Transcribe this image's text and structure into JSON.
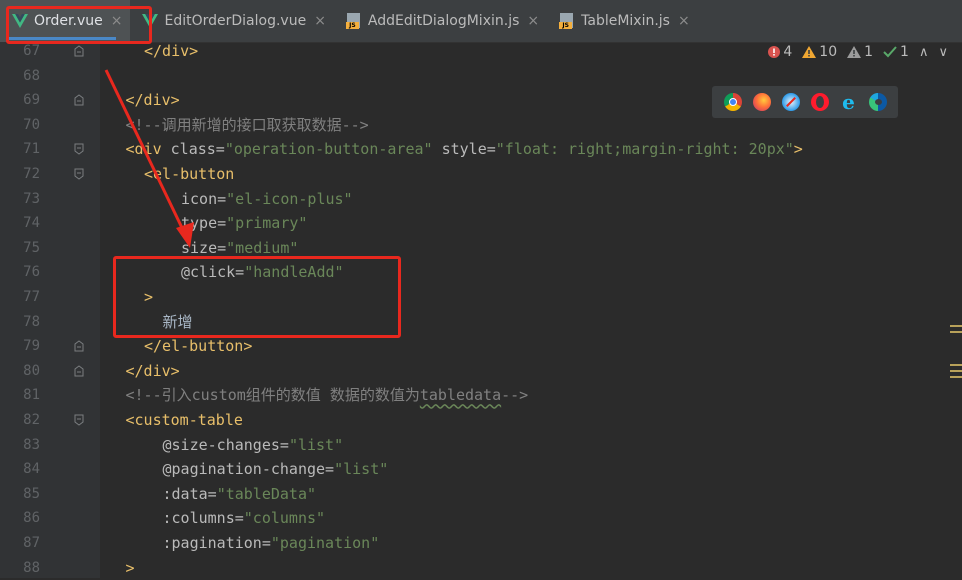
{
  "tabs": [
    {
      "label": "Order.vue",
      "icon": "vue-icon",
      "active": true
    },
    {
      "label": "EditOrderDialog.vue",
      "icon": "vue-icon",
      "active": false
    },
    {
      "label": "AddEditDialogMixin.js",
      "icon": "js-icon",
      "active": false
    },
    {
      "label": "TableMixin.js",
      "icon": "js-icon",
      "active": false
    }
  ],
  "close_glyph": "×",
  "js_badge": "JS",
  "inspections": {
    "errors": "4",
    "warnings": "10",
    "weak_warnings": "1",
    "ok": "1",
    "up": "∧",
    "down": "∨"
  },
  "browsers": [
    "chrome-icon",
    "firefox-icon",
    "safari-icon",
    "opera-icon",
    "ie-icon",
    "edge-icon"
  ],
  "lines": [
    {
      "num": "67",
      "indent": 2,
      "parts": [
        [
          "tag",
          "</div>"
        ]
      ]
    },
    {
      "num": "68",
      "indent": 0,
      "parts": []
    },
    {
      "num": "69",
      "indent": 1,
      "parts": [
        [
          "tag",
          "</div>"
        ]
      ]
    },
    {
      "num": "70",
      "indent": 1,
      "parts": [
        [
          "cmt",
          "<!--调用新增的接口取获取数据-->"
        ]
      ]
    },
    {
      "num": "71",
      "indent": 1,
      "parts": [
        [
          "tag",
          "<div "
        ],
        [
          "attr",
          "class="
        ],
        [
          "val",
          "\"operation-button-area\" "
        ],
        [
          "attr",
          "style="
        ],
        [
          "val",
          "\"float: right;margin-right: 20px\""
        ],
        [
          "tag",
          ">"
        ]
      ]
    },
    {
      "num": "72",
      "indent": 2,
      "parts": [
        [
          "tag",
          "<el-button"
        ]
      ]
    },
    {
      "num": "73",
      "indent": 4,
      "parts": [
        [
          "attr",
          "icon="
        ],
        [
          "val",
          "\"el-icon-plus\""
        ]
      ]
    },
    {
      "num": "74",
      "indent": 4,
      "parts": [
        [
          "attr",
          "type="
        ],
        [
          "val",
          "\"primary\""
        ]
      ]
    },
    {
      "num": "75",
      "indent": 4,
      "parts": [
        [
          "attr",
          "size="
        ],
        [
          "val",
          "\"medium\""
        ]
      ]
    },
    {
      "num": "76",
      "indent": 4,
      "parts": [
        [
          "attr",
          "@click="
        ],
        [
          "val",
          "\"handleAdd\""
        ]
      ]
    },
    {
      "num": "77",
      "indent": 2,
      "parts": [
        [
          "tag",
          ">"
        ]
      ]
    },
    {
      "num": "78",
      "indent": 3,
      "parts": [
        [
          "txt",
          "新增"
        ]
      ]
    },
    {
      "num": "79",
      "indent": 2,
      "parts": [
        [
          "tag",
          "</el-button>"
        ]
      ]
    },
    {
      "num": "80",
      "indent": 1,
      "parts": [
        [
          "tag",
          "</div>"
        ]
      ]
    },
    {
      "num": "81",
      "indent": 1,
      "parts": [
        [
          "cmt",
          "<!--引入custom组件的数值 数据的数值为"
        ],
        [
          "cmtu",
          "tabledata"
        ],
        [
          "cmt",
          "-->"
        ]
      ]
    },
    {
      "num": "82",
      "indent": 1,
      "parts": [
        [
          "tag",
          "<custom-table"
        ]
      ]
    },
    {
      "num": "83",
      "indent": 3,
      "parts": [
        [
          "attr",
          "@size-changes="
        ],
        [
          "val",
          "\"list\""
        ]
      ]
    },
    {
      "num": "84",
      "indent": 3,
      "parts": [
        [
          "attr",
          "@pagination-change="
        ],
        [
          "val",
          "\"list\""
        ]
      ]
    },
    {
      "num": "85",
      "indent": 3,
      "parts": [
        [
          "attr",
          ":data="
        ],
        [
          "val",
          "\"tableData\""
        ]
      ]
    },
    {
      "num": "86",
      "indent": 3,
      "parts": [
        [
          "attr",
          ":columns="
        ],
        [
          "val",
          "\"columns\""
        ]
      ]
    },
    {
      "num": "87",
      "indent": 3,
      "parts": [
        [
          "attr",
          ":pagination="
        ],
        [
          "val",
          "\"pagination\""
        ]
      ]
    },
    {
      "num": "88",
      "indent": 1,
      "parts": [
        [
          "tag",
          ">"
        ]
      ]
    }
  ],
  "colors": {
    "annotation": "#e8281e",
    "tag": "#e8bf6a",
    "value": "#6a8759",
    "comment": "#808080"
  }
}
